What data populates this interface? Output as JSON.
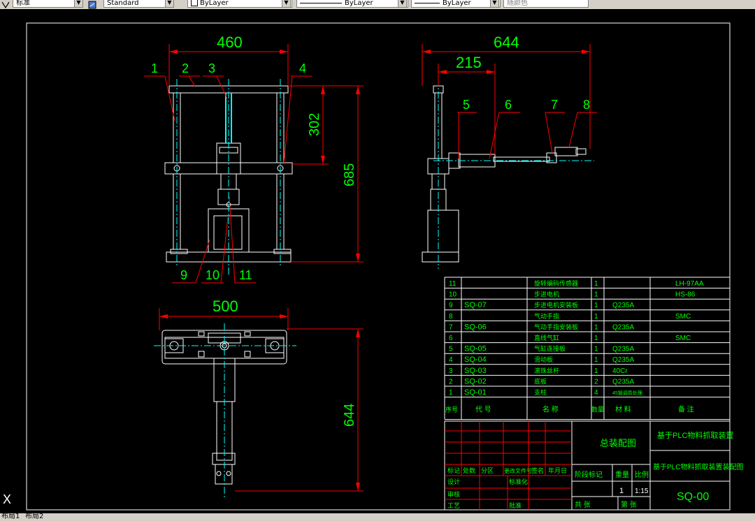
{
  "toolbar": {
    "textstyle": "标准",
    "dimstyle": "Standard",
    "layer": "ByLayer",
    "linetype": "ByLayer",
    "lineweight": "ByLayer",
    "plotstyle": "随颜色"
  },
  "drawing": {
    "front_dims": {
      "width": "460",
      "height_upper": "302",
      "height_total": "685"
    },
    "side_dims": {
      "width": "644",
      "offset": "215"
    },
    "top_dims": {
      "width": "500",
      "depth": "644"
    },
    "balloons_front": [
      "1",
      "2",
      "3",
      "4"
    ],
    "balloons_front_bottom": [
      "9",
      "10",
      "11"
    ],
    "balloons_side": [
      "5",
      "6",
      "7",
      "8"
    ],
    "ucs_icon": "X"
  },
  "bom": {
    "rows": [
      {
        "no": "11",
        "code": "",
        "name": "旋转编码传感器",
        "qty": "1",
        "material": "",
        "note": "LH-97AA"
      },
      {
        "no": "10",
        "code": "",
        "name": "步进电机",
        "qty": "1",
        "material": "",
        "note": "HS-86"
      },
      {
        "no": "9",
        "code": "SQ-07",
        "name": "步进电机安装板",
        "qty": "1",
        "material": "Q235A",
        "note": ""
      },
      {
        "no": "8",
        "code": "",
        "name": "气动手指",
        "qty": "1",
        "material": "",
        "note": "SMC"
      },
      {
        "no": "7",
        "code": "SQ-06",
        "name": "气动手指安装板",
        "qty": "1",
        "material": "Q235A",
        "note": ""
      },
      {
        "no": "6",
        "code": "",
        "name": "直线气缸",
        "qty": "1",
        "material": "",
        "note": "SMC"
      },
      {
        "no": "5",
        "code": "SQ-05",
        "name": "气缸连接板",
        "qty": "1",
        "material": "Q235A",
        "note": ""
      },
      {
        "no": "4",
        "code": "SQ-04",
        "name": "滑动板",
        "qty": "1",
        "material": "Q235A",
        "note": ""
      },
      {
        "no": "3",
        "code": "SQ-03",
        "name": "滚珠丝杆",
        "qty": "1",
        "material": "40Cr",
        "note": ""
      },
      {
        "no": "2",
        "code": "SQ-02",
        "name": "底板",
        "qty": "2",
        "material": "Q235A",
        "note": ""
      },
      {
        "no": "1",
        "code": "SQ-01",
        "name": "支柱",
        "qty": "4",
        "material": "45钢调质处理",
        "note": ""
      }
    ],
    "header": {
      "no": "序号",
      "code": "代 号",
      "name": "名 称",
      "qty": "数量",
      "material": "材 料",
      "note": "备 注"
    }
  },
  "titleblock": {
    "drawing_title": "总装配图",
    "project": "基于PLC物料抓取装置",
    "subtitle": "基于PLC物料抓取装置装配图",
    "drawing_no": "SQ-00",
    "stage_label": "阶段标记",
    "weight_label": "重量",
    "scale_label": "比例",
    "weight": "1",
    "scale": "1:15",
    "mark_labels": [
      "标记",
      "处数",
      "分区",
      "更改文件号",
      "签名",
      "年月日"
    ],
    "design_label": "设计",
    "standard_label": "标准化",
    "check_label": "审核",
    "process_label": "工艺",
    "approve_label": "批准",
    "sheets_label": "共 张",
    "sheet_label": "第 张"
  },
  "layout_tabs": [
    "布局1",
    "布局2"
  ]
}
